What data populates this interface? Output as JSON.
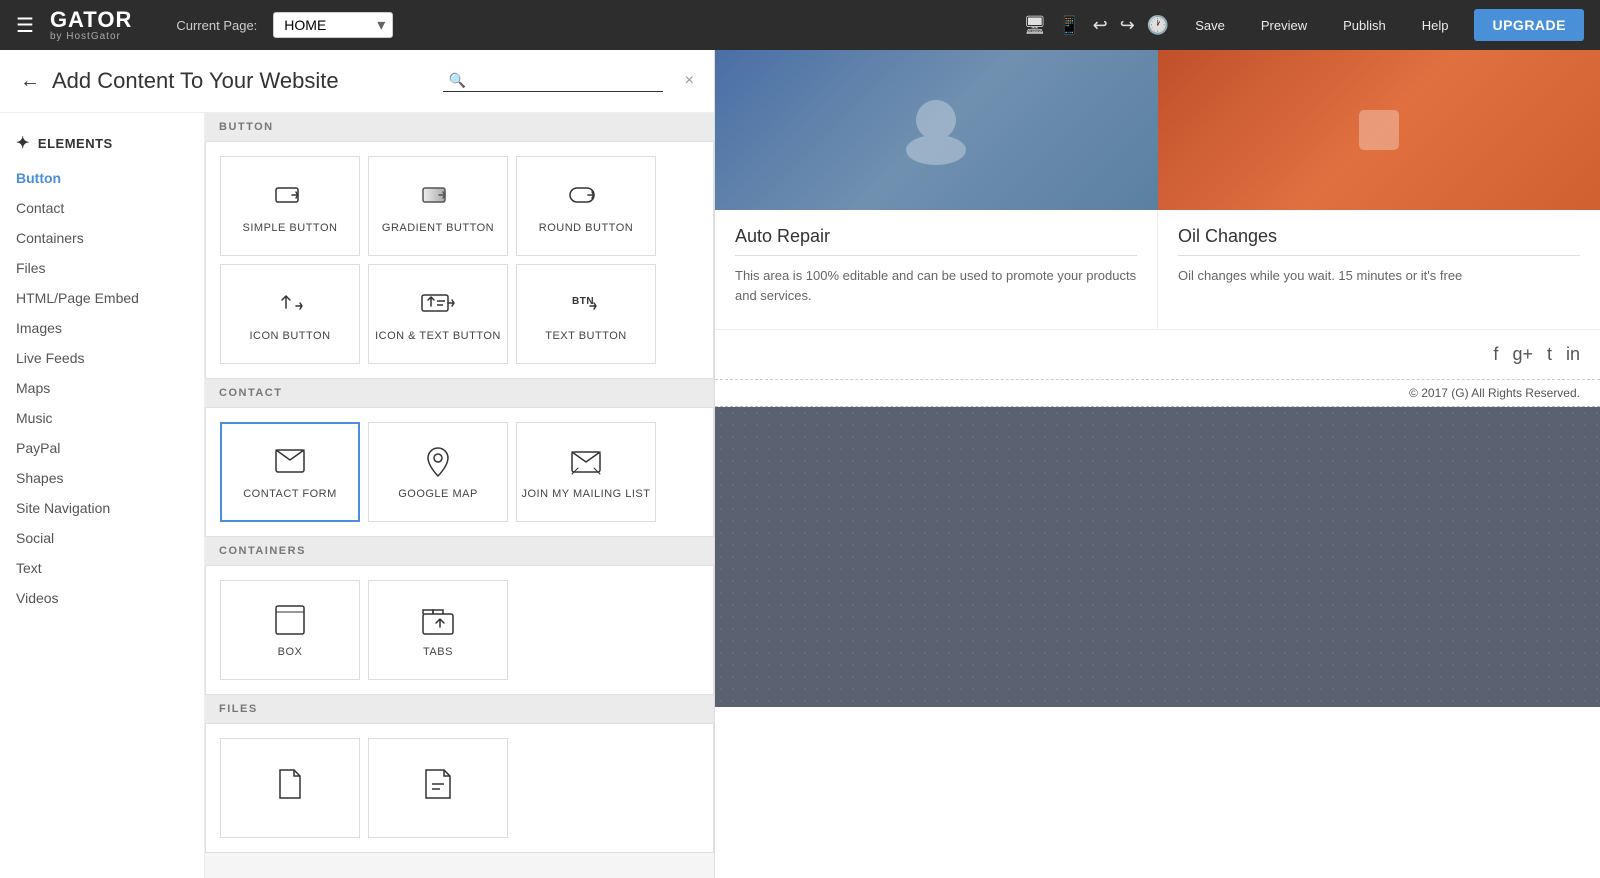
{
  "topnav": {
    "hamburger": "☰",
    "logo_main": "GATOR",
    "logo_sub": "by HostGator",
    "current_page_label": "Current Page:",
    "page_options": [
      "HOME"
    ],
    "selected_page": "HOME",
    "nav_icons": [
      "monitor",
      "tablet",
      "undo",
      "redo",
      "history"
    ],
    "save_label": "Save",
    "preview_label": "Preview",
    "publish_label": "Publish",
    "help_label": "Help",
    "upgrade_label": "UPGRADE"
  },
  "panel": {
    "back_label": "←",
    "title": "Add Content To Your Website",
    "search_placeholder": "",
    "close_label": "×"
  },
  "sidebar": {
    "section_icon": "✦",
    "section_label": "ELEMENTS",
    "items": [
      {
        "label": "Button",
        "active": true
      },
      {
        "label": "Contact",
        "active": false
      },
      {
        "label": "Containers",
        "active": false
      },
      {
        "label": "Files",
        "active": false
      },
      {
        "label": "HTML/Page Embed",
        "active": false
      },
      {
        "label": "Images",
        "active": false
      },
      {
        "label": "Live Feeds",
        "active": false
      },
      {
        "label": "Maps",
        "active": false
      },
      {
        "label": "Music",
        "active": false
      },
      {
        "label": "PayPal",
        "active": false
      },
      {
        "label": "Shapes",
        "active": false
      },
      {
        "label": "Site Navigation",
        "active": false
      },
      {
        "label": "Social",
        "active": false
      },
      {
        "label": "Text",
        "active": false
      },
      {
        "label": "Videos",
        "active": false
      }
    ]
  },
  "sections": [
    {
      "id": "button",
      "label": "BUTTON",
      "items": [
        {
          "id": "simple-button",
          "label": "SIMPLE BUTTON"
        },
        {
          "id": "gradient-button",
          "label": "GRADIENT BUTTON"
        },
        {
          "id": "round-button",
          "label": "ROUND BUTTON"
        },
        {
          "id": "icon-button",
          "label": "ICON BUTTON"
        },
        {
          "id": "icon-text-button",
          "label": "ICON & TEXT BUTTON"
        },
        {
          "id": "text-button",
          "label": "TEXT BUTTON"
        }
      ]
    },
    {
      "id": "contact",
      "label": "CONTACT",
      "items": [
        {
          "id": "contact-form",
          "label": "CONTACT FORM",
          "selected": true
        },
        {
          "id": "google-map",
          "label": "GOOGLE MAP"
        },
        {
          "id": "mailing-list",
          "label": "JOIN MY MAILING LIST"
        }
      ]
    },
    {
      "id": "containers",
      "label": "CONTAINERS",
      "items": [
        {
          "id": "box",
          "label": "BOX"
        },
        {
          "id": "tabs",
          "label": "TABS"
        }
      ]
    },
    {
      "id": "files",
      "label": "FILES",
      "items": [
        {
          "id": "file1",
          "label": ""
        },
        {
          "id": "file2",
          "label": ""
        }
      ]
    }
  ],
  "preview": {
    "cards": [
      {
        "title": "Auto Repair",
        "text": "This area is 100% editable and can be used to promote your products and services."
      },
      {
        "title": "Oil Changes",
        "text": "Oil changes while you wait. 15 minutes or it's free"
      }
    ],
    "footer_copy": "© 2017  (G)  All Rights Reserved.",
    "social_icons": [
      "f",
      "g+",
      "t",
      "in"
    ]
  }
}
